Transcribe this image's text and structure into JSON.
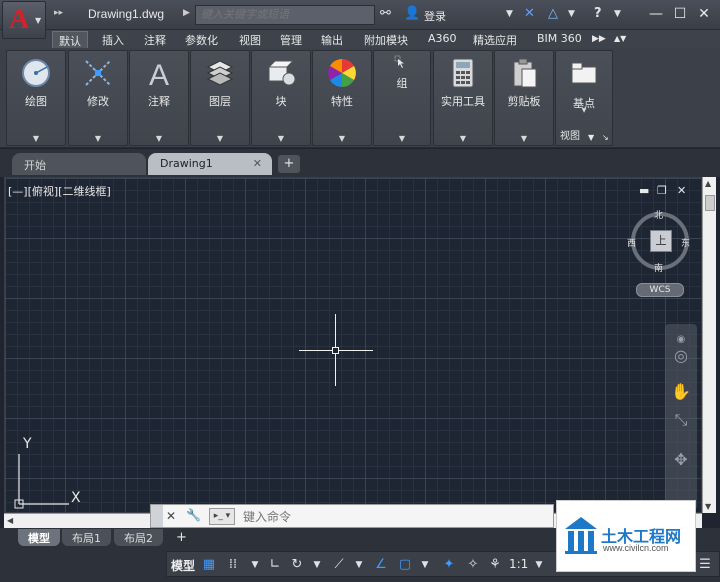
{
  "titlebar": {
    "app_logo": "A",
    "doc_title": "Drawing1.dwg",
    "search_placeholder": "键入关键字或短语",
    "login_label": "登录"
  },
  "ribbon_tabs": [
    "默认",
    "插入",
    "注释",
    "参数化",
    "视图",
    "管理",
    "输出",
    "附加模块",
    "A360",
    "精选应用",
    "BIM 360"
  ],
  "ribbon_panels": [
    {
      "label": "绘图",
      "icon": "circle-draw-icon"
    },
    {
      "label": "修改",
      "icon": "modify-icon"
    },
    {
      "label": "注释",
      "icon": "annotation-icon"
    },
    {
      "label": "图层",
      "icon": "layers-icon"
    },
    {
      "label": "块",
      "icon": "block-icon"
    },
    {
      "label": "特性",
      "icon": "properties-icon"
    },
    {
      "label": "组",
      "icon": "group-icon"
    },
    {
      "label": "实用工具",
      "icon": "calculator-icon"
    },
    {
      "label": "剪贴板",
      "icon": "clipboard-icon"
    },
    {
      "label": "基点",
      "icon": "basepoint-icon"
    }
  ],
  "ribbon_view_label": "视图",
  "file_tabs": {
    "start": "开始",
    "drawing": "Drawing1"
  },
  "viewport": {
    "view_label": "[—][俯视][二维线框]",
    "compass": {
      "north": "北",
      "south": "南",
      "east": "东",
      "west": "西",
      "top": "上"
    },
    "wcs": "WCS"
  },
  "ucs": {
    "x": "X",
    "y": "Y"
  },
  "command": {
    "placeholder": "键入命令"
  },
  "layout_tabs": [
    "模型",
    "布局1",
    "布局2"
  ],
  "status": {
    "model": "模型",
    "scale": "1:1"
  },
  "watermark": {
    "text": "土木工程网",
    "url": "www.civilcn.com"
  },
  "colors": {
    "accent": "#3e9bff",
    "logo": "#d2232a",
    "canvas": "#1f2633"
  }
}
